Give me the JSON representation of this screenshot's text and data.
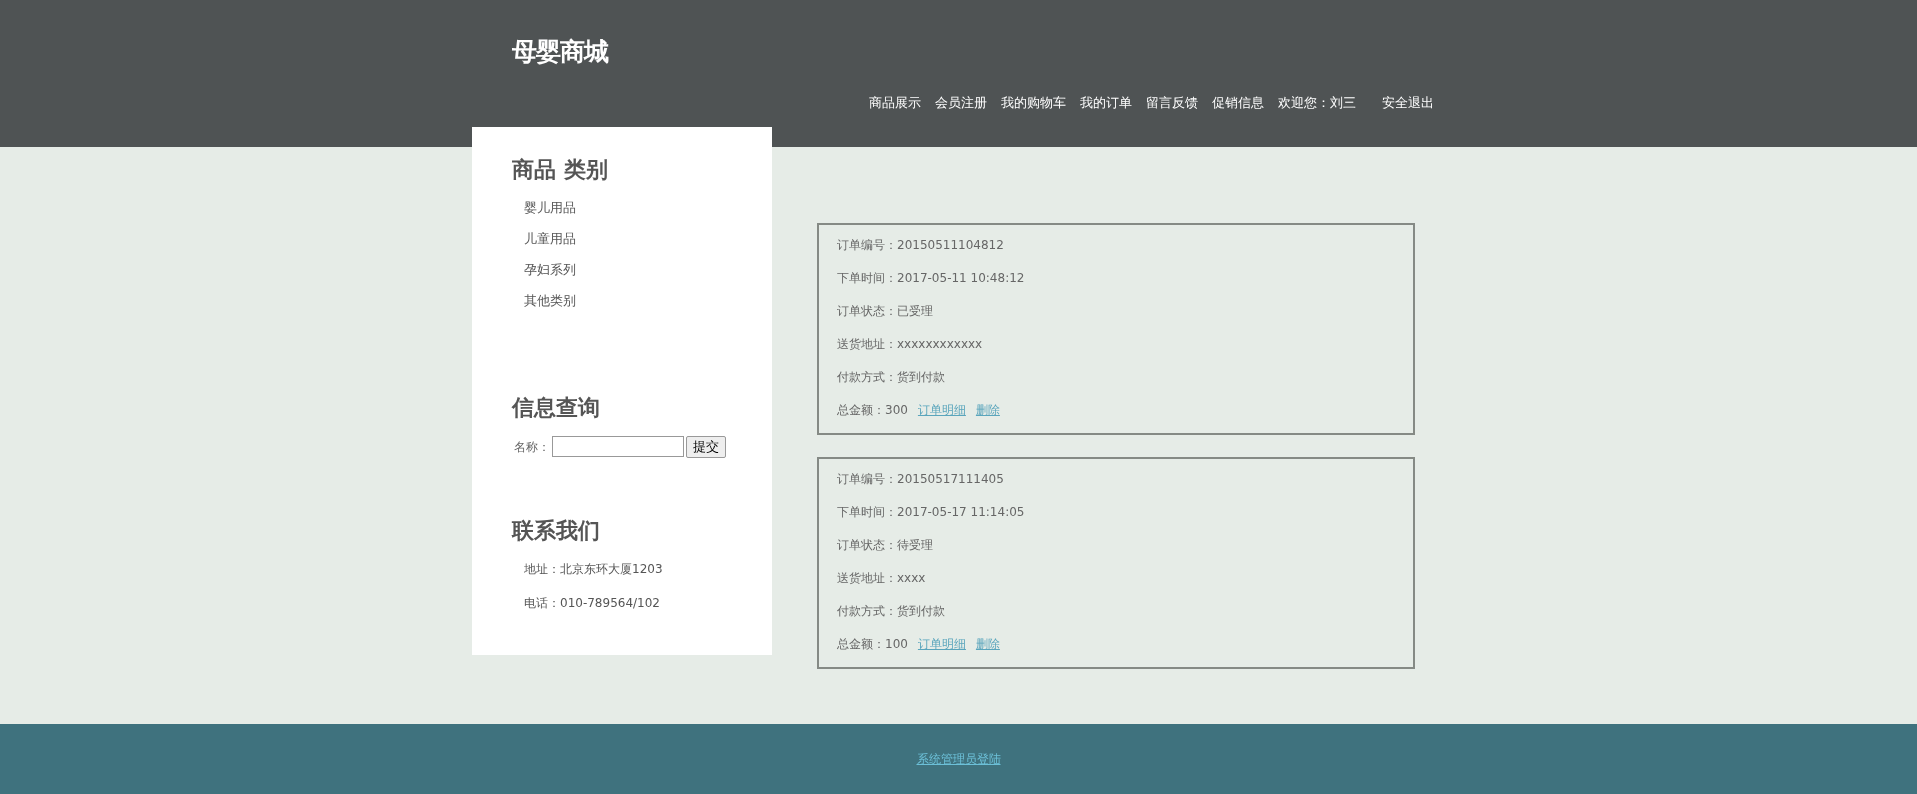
{
  "header": {
    "logo": "母婴商城",
    "nav": [
      {
        "label": "商品展示",
        "kind": "link"
      },
      {
        "label": "会员注册",
        "kind": "link"
      },
      {
        "label": "我的购物车",
        "kind": "link"
      },
      {
        "label": "我的订单",
        "kind": "link"
      },
      {
        "label": "留言反馈",
        "kind": "link"
      },
      {
        "label": "促销信息",
        "kind": "link"
      },
      {
        "label": "欢迎您：刘三",
        "kind": "text"
      },
      {
        "label": "安全退出",
        "kind": "link"
      }
    ]
  },
  "sidebar": {
    "categories": {
      "title": "商品 类别",
      "items": [
        "婴儿用品",
        "儿童用品",
        "孕妇系列",
        "其他类别"
      ]
    },
    "search": {
      "title": "信息查询",
      "label": "名称：",
      "button": "提交"
    },
    "contact": {
      "title": "联系我们",
      "lines": [
        "地址：北京东环大厦1203",
        "电话：010-789564/102"
      ]
    }
  },
  "orders": [
    {
      "lines": [
        "订单编号：20150511104812",
        "下单时间：2017-05-11 10:48:12",
        "订单状态：已受理",
        "送货地址：xxxxxxxxxxxx",
        "付款方式：货到付款"
      ],
      "total": "总金额：300",
      "links": [
        "订单明细",
        "删除"
      ]
    },
    {
      "lines": [
        "订单编号：20150517111405",
        "下单时间：2017-05-17 11:14:05",
        "订单状态：待受理",
        "送货地址：xxxx",
        "付款方式：货到付款"
      ],
      "total": "总金额：100",
      "links": [
        "订单明细",
        "删除"
      ]
    }
  ],
  "footer": {
    "link": "系统管理员登陆"
  }
}
